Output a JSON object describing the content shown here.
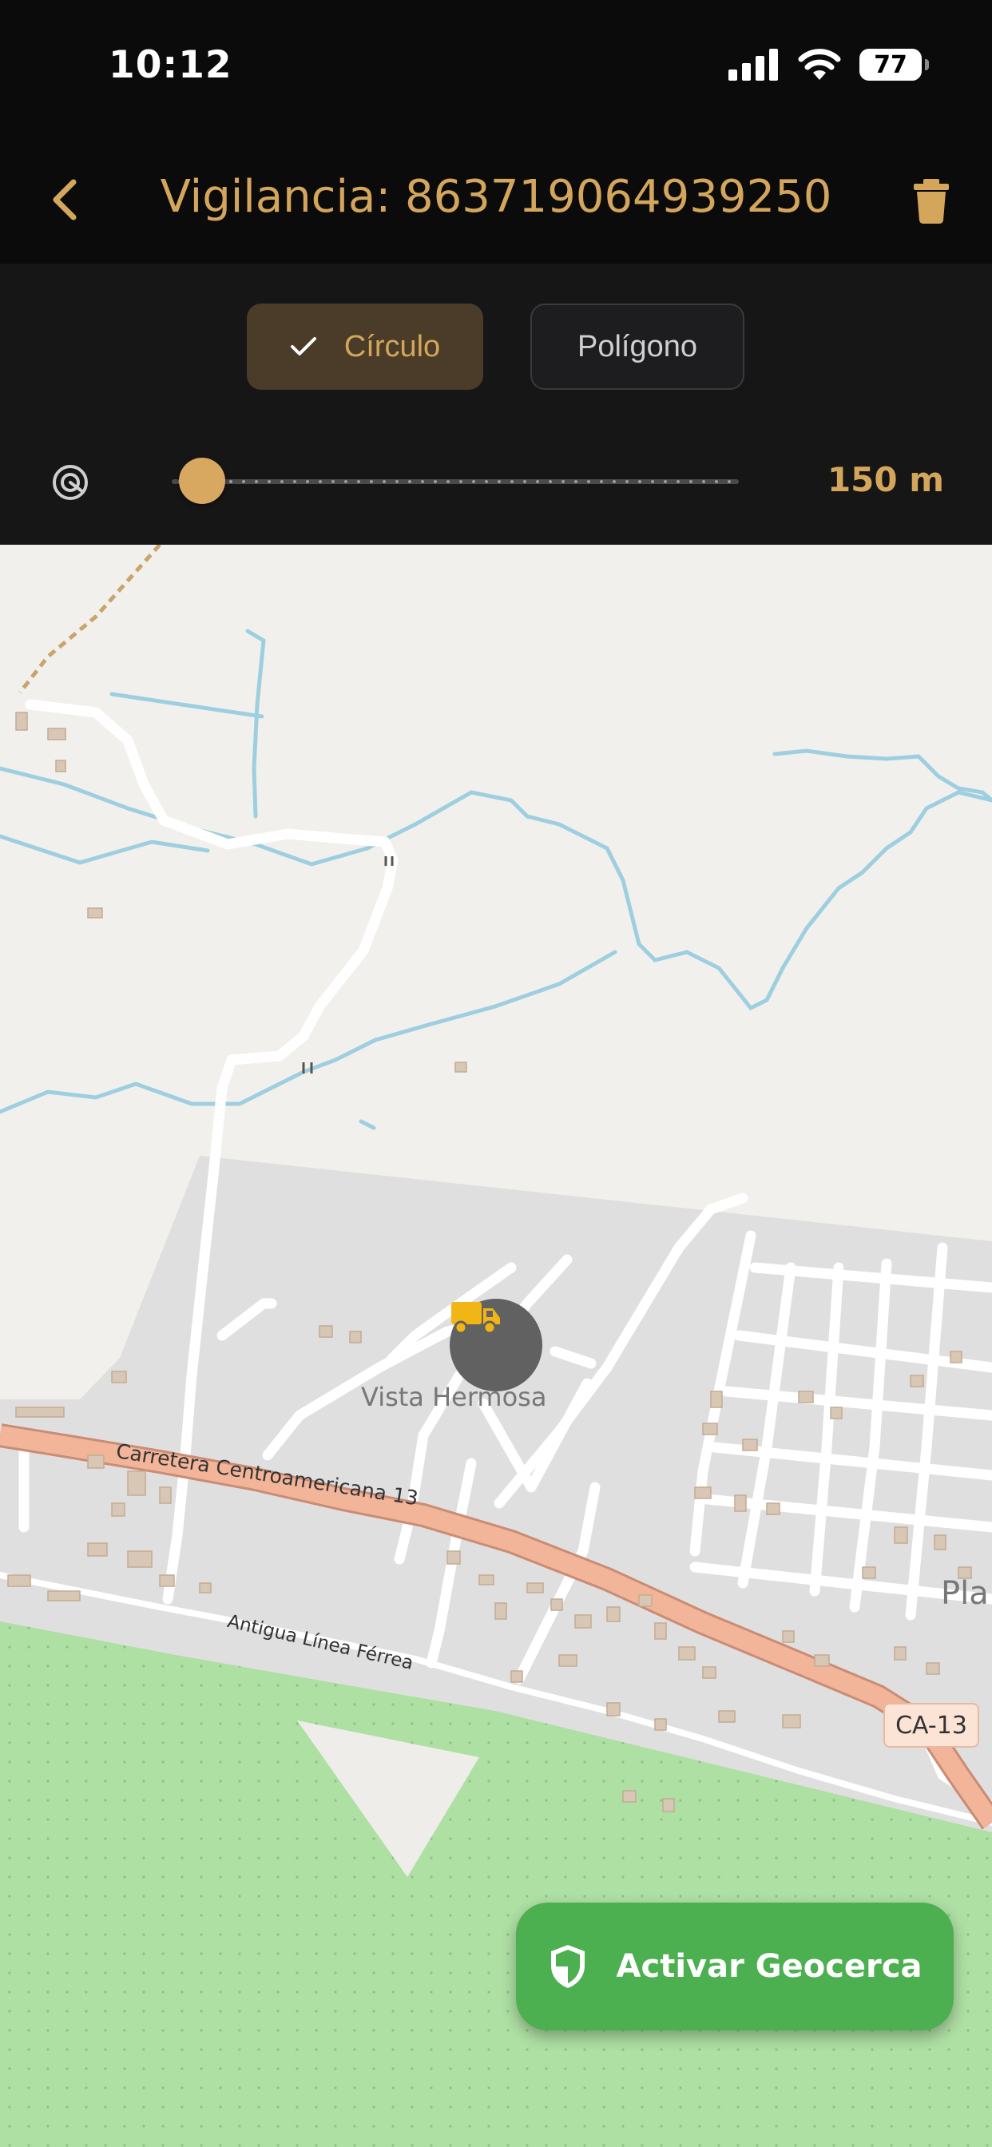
{
  "status_bar": {
    "time": "10:12",
    "battery": "77"
  },
  "header": {
    "title": "Vigilancia: 863719064939250",
    "back_icon": "chevron-left-icon",
    "delete_icon": "trash-icon"
  },
  "mode_selector": {
    "options": [
      {
        "label": "Círculo",
        "selected": true
      },
      {
        "label": "Polígono",
        "selected": false
      }
    ]
  },
  "radius": {
    "value_label": "150 m",
    "slider_fraction": 0.04
  },
  "map": {
    "place_labels": [
      "Vista Hermosa",
      "Pla"
    ],
    "road_labels": [
      "Carretera Centroamericana 13",
      "Antigua Línea Férrea"
    ],
    "route_shield": "CA-13",
    "marker_icon": "truck-icon"
  },
  "action_button": {
    "label": "Activar Geocerca",
    "icon": "shield-icon"
  },
  "colors": {
    "accent": "#d4a65c",
    "primary_action": "#4caf50",
    "water": "#9ecfe0",
    "forest": "#aedfa3",
    "major_road": "#f3b59a"
  }
}
